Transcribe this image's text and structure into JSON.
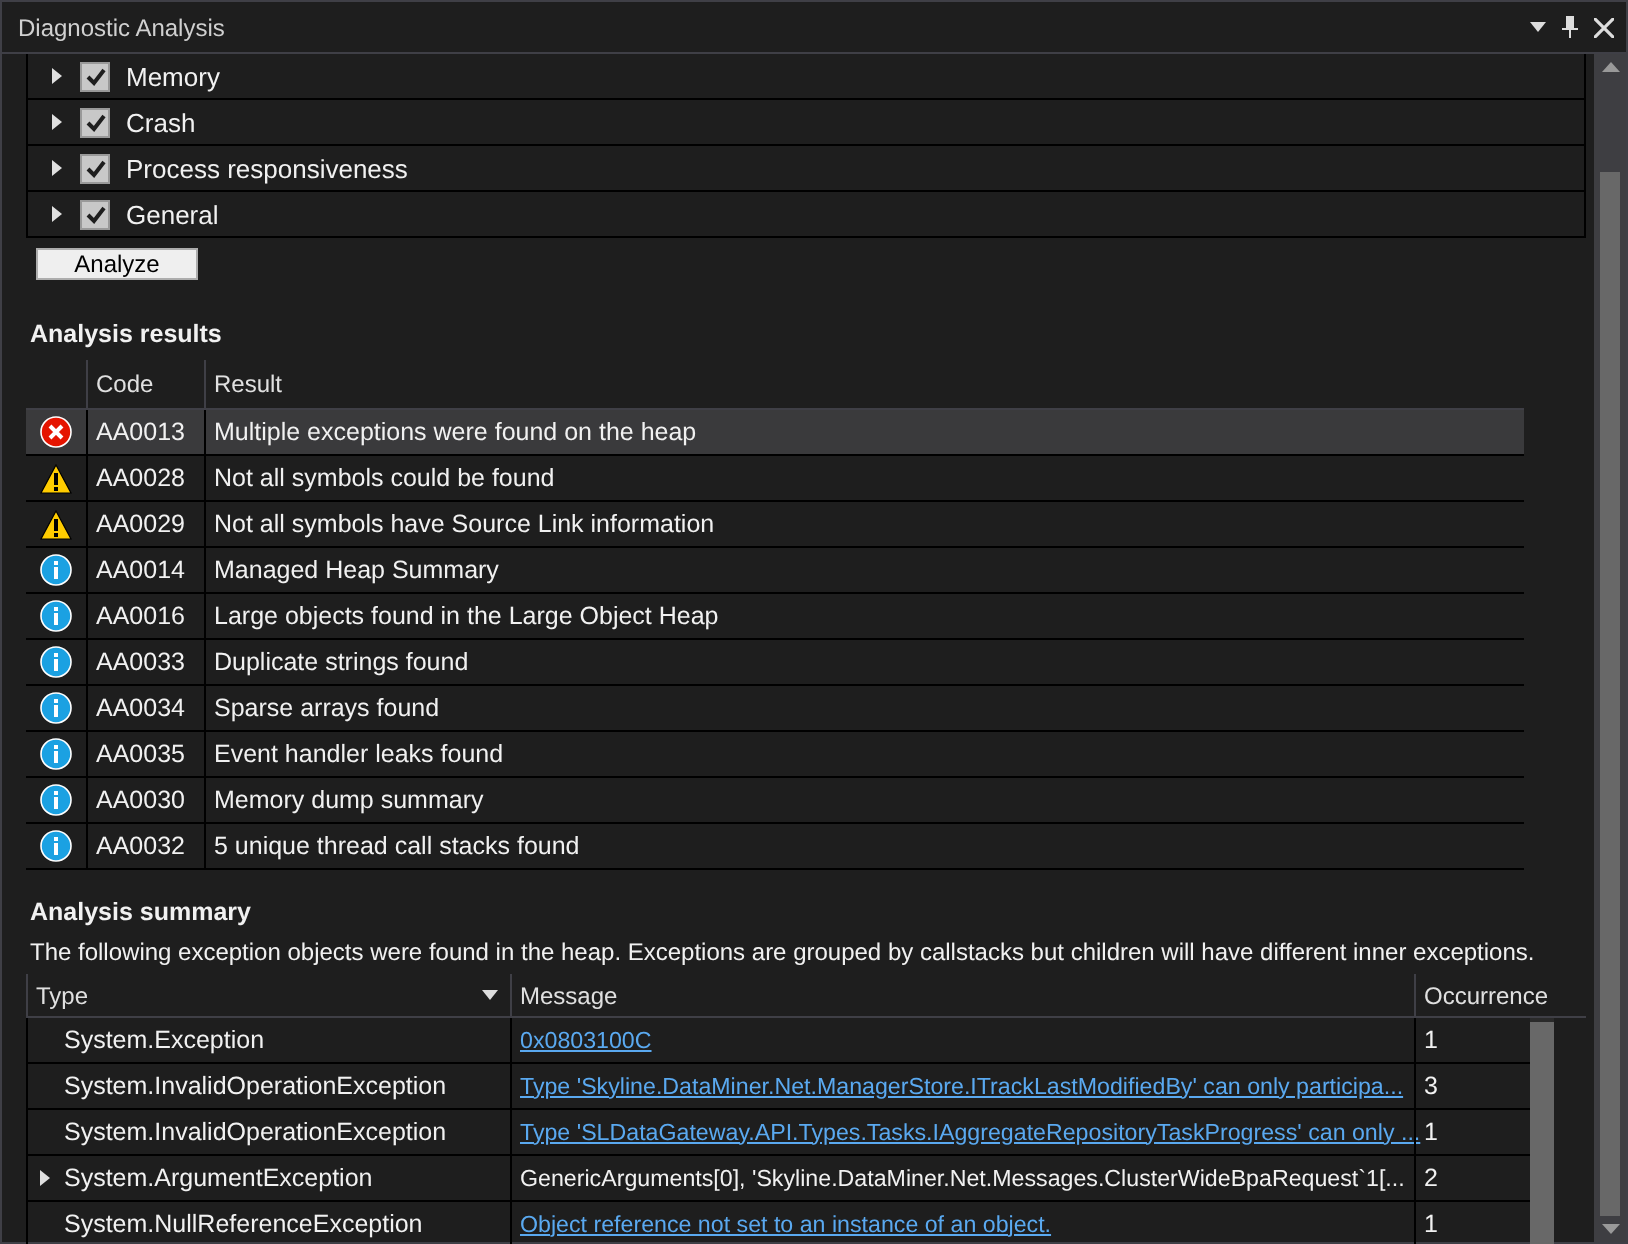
{
  "window": {
    "title": "Diagnostic Analysis"
  },
  "analyzers": [
    {
      "label": "Memory",
      "checked": true,
      "expanded": false
    },
    {
      "label": "Crash",
      "checked": true,
      "expanded": false
    },
    {
      "label": "Process responsiveness",
      "checked": true,
      "expanded": false
    },
    {
      "label": "General",
      "checked": true,
      "expanded": false
    }
  ],
  "analyze_button": "Analyze",
  "results": {
    "title": "Analysis results",
    "columns": [
      "Code",
      "Result"
    ],
    "rows": [
      {
        "kind": "error",
        "code": "AA0013",
        "result": "Multiple exceptions were found on the heap",
        "selected": true
      },
      {
        "kind": "warning",
        "code": "AA0028",
        "result": "Not all symbols could be found",
        "selected": false
      },
      {
        "kind": "warning",
        "code": "AA0029",
        "result": "Not all symbols have Source Link information",
        "selected": false
      },
      {
        "kind": "info",
        "code": "AA0014",
        "result": "Managed Heap Summary",
        "selected": false
      },
      {
        "kind": "info",
        "code": "AA0016",
        "result": "Large objects found in the Large Object Heap",
        "selected": false
      },
      {
        "kind": "info",
        "code": "AA0033",
        "result": "Duplicate strings found",
        "selected": false
      },
      {
        "kind": "info",
        "code": "AA0034",
        "result": "Sparse arrays found",
        "selected": false
      },
      {
        "kind": "info",
        "code": "AA0035",
        "result": "Event handler leaks found",
        "selected": false
      },
      {
        "kind": "info",
        "code": "AA0030",
        "result": "Memory dump summary",
        "selected": false
      },
      {
        "kind": "info",
        "code": "AA0032",
        "result": "5 unique thread call stacks found",
        "selected": false
      }
    ]
  },
  "summary": {
    "title": "Analysis summary",
    "description": "The following exception objects were found in the heap. Exceptions are grouped by callstacks but children will have different inner exceptions.",
    "columns": [
      "Type",
      "Message",
      "Occurrence"
    ],
    "rows": [
      {
        "type": "System.Exception",
        "message": "0x0803100C",
        "link": true,
        "occurrence": "1",
        "expandable": false
      },
      {
        "type": "System.InvalidOperationException",
        "message": "Type 'Skyline.DataMiner.Net.ManagerStore.ITrackLastModifiedBy' can only participa...",
        "link": true,
        "occurrence": "3",
        "expandable": false
      },
      {
        "type": "System.InvalidOperationException",
        "message": "Type 'SLDataGateway.API.Types.Tasks.IAggregateRepositoryTaskProgress' can only ...",
        "link": true,
        "occurrence": "1",
        "expandable": false
      },
      {
        "type": "System.ArgumentException",
        "message": "GenericArguments[0], 'Skyline.DataMiner.Net.Messages.ClusterWideBpaRequest`1[...",
        "link": false,
        "occurrence": "2",
        "expandable": true
      },
      {
        "type": "System.NullReferenceException",
        "message": "Object reference not set to an instance of an object.",
        "link": true,
        "occurrence": "1",
        "expandable": false
      }
    ]
  }
}
